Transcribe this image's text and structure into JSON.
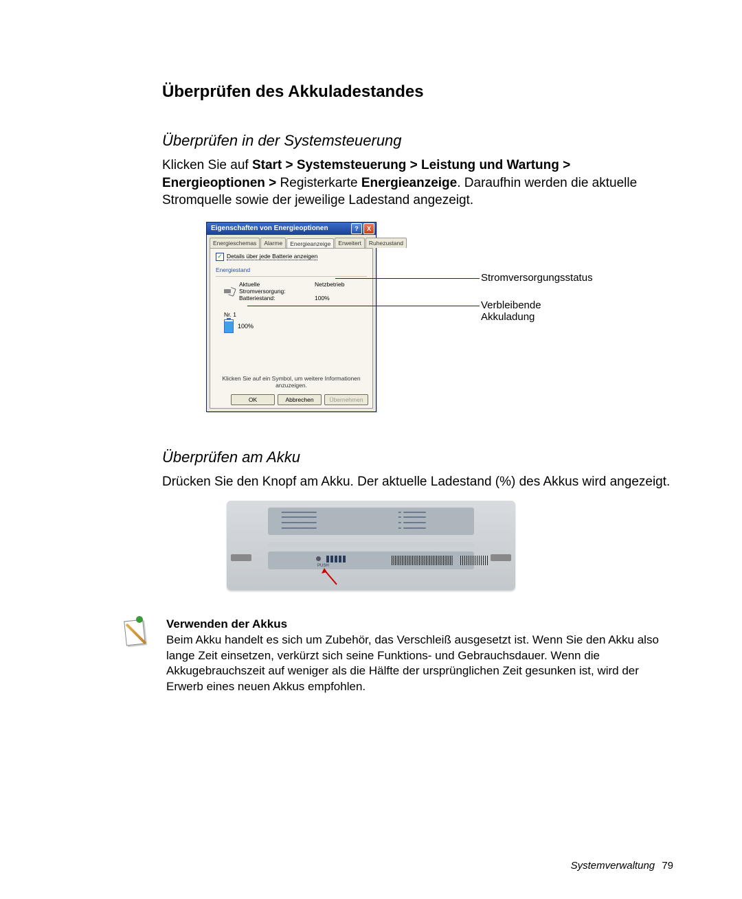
{
  "heading": "Überprüfen des Akkuladestandes",
  "section1": {
    "title": "Überprüfen in der Systemsteuerung",
    "intro_pre": "Klicken Sie auf ",
    "path": "Start > Systemsteuerung > Leistung und Wartung > Energieoptionen >",
    "intro_mid": " Registerkarte ",
    "tabname": "Energieanzeige",
    "intro_post": ". Daraufhin werden die aktuelle Stromquelle sowie der jeweilige Ladestand angezeigt."
  },
  "dialog": {
    "title": "Eigenschaften von Energieoptionen",
    "help": "?",
    "close": "X",
    "tabs": [
      "Energieschemas",
      "Alarme",
      "Energieanzeige",
      "Erweitert",
      "Ruhezustand"
    ],
    "active_tab_index": 2,
    "checkbox_label": "Details über jede Batterie anzeigen",
    "group_label": "Energiestand",
    "supply_label": "Aktuelle Stromversorgung:",
    "supply_value": "Netzbetrieb",
    "level_label": "Batteriestand:",
    "level_value": "100%",
    "batt_nr": "Nr. 1",
    "batt_pct": "100%",
    "hint": "Klicken Sie auf ein Symbol, um weitere Informationen anzuzeigen.",
    "ok": "OK",
    "cancel": "Abbrechen",
    "apply": "Übernehmen"
  },
  "callouts": {
    "status": "Stromversorgungsstatus",
    "remaining": "Verbleibende Akkuladung"
  },
  "section2": {
    "title": "Überprüfen am Akku",
    "text": "Drücken Sie den Knopf am Akku. Der aktuelle Ladestand (%) des Akkus wird angezeigt."
  },
  "battery_fig": {
    "push_label": "PUSH"
  },
  "note": {
    "title": "Verwenden der Akkus",
    "text": "Beim Akku handelt es sich um Zubehör, das Verschleiß ausgesetzt ist. Wenn Sie den Akku also lange Zeit einsetzen, verkürzt sich seine Funktions- und Gebrauchsdauer. Wenn die Akkugebrauchszeit auf weniger als die Hälfte der ursprünglichen Zeit gesunken ist, wird der Erwerb eines neuen Akkus empfohlen."
  },
  "footer": {
    "section": "Systemverwaltung",
    "page": "79"
  }
}
